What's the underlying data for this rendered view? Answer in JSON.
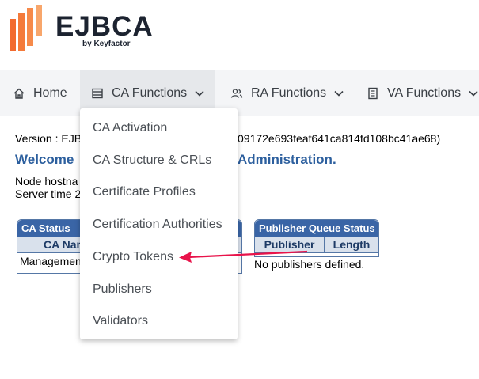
{
  "brand": {
    "name": "EJBCA",
    "tagline": "by Keyfactor",
    "colors": {
      "orange": "#f26a2e",
      "orange_light": "#f8a66b"
    }
  },
  "nav": {
    "home": {
      "label": "Home",
      "icon": "home-icon"
    },
    "ca": {
      "label": "CA Functions",
      "icon": "server-icon"
    },
    "ra": {
      "label": "RA Functions",
      "icon": "users-icon"
    },
    "va": {
      "label": "VA Functions",
      "icon": "document-icon"
    }
  },
  "dropdown": {
    "items": [
      {
        "label": "CA Activation"
      },
      {
        "label": "CA Structure & CRLs"
      },
      {
        "label": "Certificate Profiles"
      },
      {
        "label": "Certification Authorities"
      },
      {
        "label": "Crypto Tokens"
      },
      {
        "label": "Publishers"
      },
      {
        "label": "Validators"
      }
    ]
  },
  "main": {
    "version_prefix": "Version : EJB",
    "version_suffix": "09172e693feaf641ca814fd108bc41ae68)",
    "welcome_prefix": "Welcome",
    "welcome_suffix": "Administration.",
    "node_hostname": "Node hostna",
    "server_time": "Server time 2"
  },
  "ca_status": {
    "title": "CA Status",
    "column": "CA Nam",
    "row": "Managemen"
  },
  "publisher_queue": {
    "title": "Publisher Queue Status",
    "columns": [
      "Publisher",
      "Length"
    ],
    "empty": "No publishers defined."
  },
  "annotation": {
    "color": "#e8134a"
  }
}
